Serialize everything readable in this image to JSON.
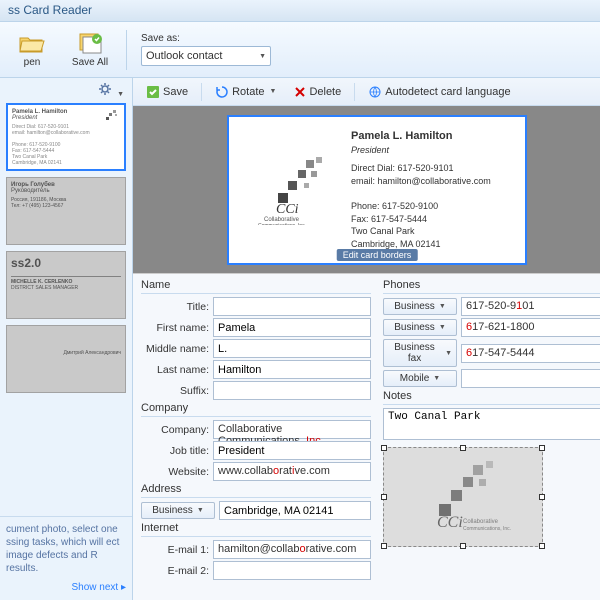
{
  "app": {
    "title": "ss Card Reader"
  },
  "ribbon": {
    "open": "pen",
    "save_all": "Save All",
    "save_as_label": "Save as:",
    "save_as_value": "Outlook contact"
  },
  "toolbar": {
    "save": "Save",
    "rotate": "Rotate",
    "delete": "Delete",
    "autodetect": "Autodetect card language"
  },
  "preview": {
    "name": "Pamela L. Hamilton",
    "title": "President",
    "line1": "Direct Dial: 617-520-9101",
    "line2": "email: hamilton@collaborative.com",
    "line3": "Phone: 617-520-9100",
    "line4": "Fax: 617-547-5444",
    "line5": "Two Canal Park",
    "line6": "Cambridge, MA 02141",
    "company_sub": "Collaborative Communications, Inc.",
    "edit_borders": "Edit card borders"
  },
  "sections": {
    "name": "Name",
    "company": "Company",
    "address": "Address",
    "internet": "Internet",
    "phones": "Phones",
    "notes": "Notes"
  },
  "labels": {
    "title": "Title:",
    "first_name": "First name:",
    "middle_name": "Middle name:",
    "last_name": "Last name:",
    "suffix": "Suffix:",
    "company": "Company:",
    "job_title": "Job title:",
    "website": "Website:",
    "email1": "E-mail 1:",
    "email2": "E-mail 2:"
  },
  "phone_types": {
    "business": "Business",
    "business_fax": "Business fax",
    "mobile": "Mobile"
  },
  "address_types": {
    "business": "Business"
  },
  "values": {
    "title": "",
    "first_name": "Pamela",
    "middle_name": "L.",
    "last_name": "Hamilton",
    "suffix": "",
    "company": "Collaborative Communications, Inc",
    "job_title": "President",
    "website": "www.collaborative.com",
    "address": "Cambridge, MA 02141",
    "email1": "hamilton@collaborative.com",
    "email2": "",
    "phone1": "617-520-9101",
    "phone2": "617-621-1800",
    "phone3": "617-547-5444",
    "phone4": "",
    "notes": "Two Canal Park"
  },
  "tip": {
    "text": "cument photo, select one ssing tasks, which will ect image defects and R results.",
    "show_next": "Show next"
  },
  "thumbs": [
    {
      "name": "Pamela L. Hamilton",
      "sub": "President"
    },
    {
      "name": "Игорь Голубев",
      "sub": "Руководитель"
    },
    {
      "name": "ss2.0",
      "sub": "MICHELLE K. CERLENKO"
    },
    {
      "name": "",
      "sub": "Дмитрий Александрович"
    }
  ]
}
